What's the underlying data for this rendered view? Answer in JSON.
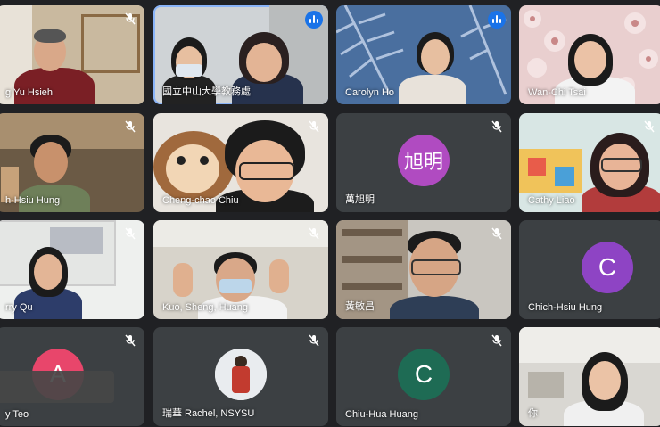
{
  "participants": [
    {
      "name": "g Yu Hsieh",
      "mic": "muted"
    },
    {
      "name": "國立中山大學教務處",
      "mic": "speaking"
    },
    {
      "name": "Carolyn Ho",
      "mic": "speaking"
    },
    {
      "name": "Wan-Chi Tsai",
      "mic": "none"
    },
    {
      "name": "h-Hsiu Hung",
      "mic": "muted"
    },
    {
      "name": "Cheng-chao Chiu",
      "mic": "muted"
    },
    {
      "name": "萬旭明",
      "mic": "muted",
      "avatar_text": "旭明",
      "avatar_color": "#b04bc1"
    },
    {
      "name": "Cathy Liao",
      "mic": "muted"
    },
    {
      "name": "rry Qu",
      "mic": "muted"
    },
    {
      "name": "Kuo, Sheng, Huang",
      "mic": "muted"
    },
    {
      "name": "黃敏昌",
      "mic": "muted"
    },
    {
      "name": "Chich-Hsiu Hung",
      "mic": "none",
      "avatar_text": "C",
      "avatar_color": "#8e44c4"
    },
    {
      "name": "y Teo",
      "mic": "muted",
      "avatar_text": "A",
      "avatar_color": "#e8466b"
    },
    {
      "name": "瑞華 Rachel, NSYSU",
      "mic": "muted"
    },
    {
      "name": "Chiu-Hua Huang",
      "mic": "muted",
      "avatar_text": "C",
      "avatar_color": "#1e6b54"
    },
    {
      "name": "你",
      "mic": "none"
    }
  ],
  "colors": {
    "background": "#202124",
    "tile": "#3c4043",
    "speaking": "#1a73e8",
    "active_border": "#8ab4f8"
  }
}
